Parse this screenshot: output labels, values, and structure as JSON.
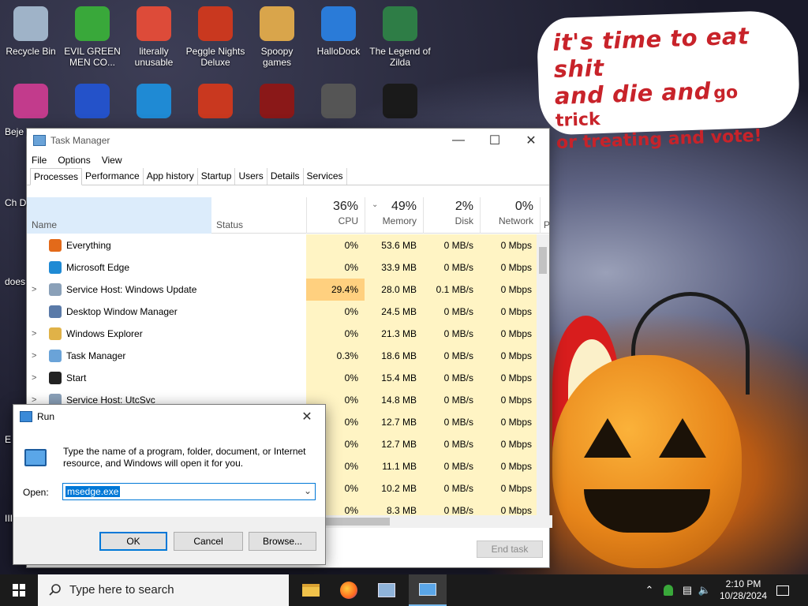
{
  "desktop": {
    "icons": [
      {
        "label": "Recycle Bin",
        "icon": "recycle-bin-icon",
        "color": "#9fb3c8"
      },
      {
        "label": "EVIL GREEN MEN CO...",
        "icon": "messenger-icon",
        "color": "#39a83a"
      },
      {
        "label": "literally unusable",
        "icon": "chrome-icon",
        "color": "#dd4b39"
      },
      {
        "label": "Peggle Nights Deluxe",
        "icon": "peggle-icon",
        "color": "#c9381f"
      },
      {
        "label": "Spoopy games",
        "icon": "folder-icon",
        "color": "#d9a54b"
      },
      {
        "label": "HalloDock",
        "icon": "windows-shield-icon",
        "color": "#2a7bd8"
      },
      {
        "label": "The Legend of Zilda",
        "icon": "zilda-icon",
        "color": "#2e7d46"
      }
    ],
    "row2_icons": [
      {
        "label": "Beje... De...",
        "icon": "bejeweled-icon",
        "color": "#c23b8c"
      },
      {
        "label": "",
        "icon": "mpl-icon",
        "color": "#2452c9"
      },
      {
        "label": "",
        "icon": "edge-icon",
        "color": "#1f8ad4"
      },
      {
        "label": "",
        "icon": "peggle-icon",
        "color": "#c9381f"
      },
      {
        "label": "",
        "icon": "flash-icon",
        "color": "#8a1818"
      },
      {
        "label": "",
        "icon": "rdp-icon",
        "color": "#555555"
      },
      {
        "label": "",
        "icon": "yashma-icon",
        "color": "#1a1a1a"
      }
    ],
    "left_edge": [
      "Beje De",
      "Ch De",
      "does",
      "E",
      "III"
    ]
  },
  "bubble": {
    "line1a": "it's time to eat shit",
    "line1b": "and die and",
    "line1c": "go trick",
    "line2": "or treating and vote!"
  },
  "task_manager": {
    "title": "Task Manager",
    "menu": [
      "File",
      "Options",
      "View"
    ],
    "tabs": [
      "Processes",
      "Performance",
      "App history",
      "Startup",
      "Users",
      "Details",
      "Services"
    ],
    "columns": {
      "name": "Name",
      "status": "Status",
      "cpu": {
        "pct": "36%",
        "label": "CPU"
      },
      "memory": {
        "pct": "49%",
        "label": "Memory"
      },
      "disk": {
        "pct": "2%",
        "label": "Disk"
      },
      "network": {
        "pct": "0%",
        "label": "Network"
      },
      "power": {
        "label": "P"
      }
    },
    "rows": [
      {
        "name": "Everything",
        "cpu": "0%",
        "memory": "53.6 MB",
        "disk": "0 MB/s",
        "network": "0 Mbps",
        "expand": "",
        "icon": "everything-icon",
        "icolor": "#e36a1a"
      },
      {
        "name": "Microsoft Edge",
        "cpu": "0%",
        "memory": "33.9 MB",
        "disk": "0 MB/s",
        "network": "0 Mbps",
        "expand": "",
        "icon": "edge-icon",
        "icolor": "#1f8ad4"
      },
      {
        "name": "Service Host: Windows Update",
        "cpu": "29.4%",
        "memory": "28.0 MB",
        "disk": "0.1 MB/s",
        "network": "0 Mbps",
        "expand": ">",
        "icon": "gear-icon",
        "icolor": "#8aa0b8"
      },
      {
        "name": "Desktop Window Manager",
        "cpu": "0%",
        "memory": "24.5 MB",
        "disk": "0 MB/s",
        "network": "0 Mbps",
        "expand": "",
        "icon": "window-icon",
        "icolor": "#5a7aa8"
      },
      {
        "name": "Windows Explorer",
        "cpu": "0%",
        "memory": "21.3 MB",
        "disk": "0 MB/s",
        "network": "0 Mbps",
        "expand": ">",
        "icon": "folder-icon",
        "icolor": "#e0b248"
      },
      {
        "name": "Task Manager",
        "cpu": "0.3%",
        "memory": "18.6 MB",
        "disk": "0 MB/s",
        "network": "0 Mbps",
        "expand": ">",
        "icon": "task-manager-icon",
        "icolor": "#6aa3d8"
      },
      {
        "name": "Start",
        "cpu": "0%",
        "memory": "15.4 MB",
        "disk": "0 MB/s",
        "network": "0 Mbps",
        "expand": ">",
        "icon": "start-icon",
        "icolor": "#222222"
      },
      {
        "name": "Service Host: UtcSvc",
        "cpu": "0%",
        "memory": "14.8 MB",
        "disk": "0 MB/s",
        "network": "0 Mbps",
        "expand": ">",
        "icon": "gear-icon",
        "icolor": "#8aa0b8"
      },
      {
        "name": "",
        "cpu": "0%",
        "memory": "12.7 MB",
        "disk": "0 MB/s",
        "network": "0 Mbps",
        "expand": "",
        "icon": "",
        "icolor": "#ffffff"
      },
      {
        "name": "",
        "cpu": "0%",
        "memory": "12.7 MB",
        "disk": "0 MB/s",
        "network": "0 Mbps",
        "expand": "",
        "icon": "",
        "icolor": "#ffffff"
      },
      {
        "name": "",
        "cpu": "0%",
        "memory": "11.1 MB",
        "disk": "0 MB/s",
        "network": "0 Mbps",
        "expand": "",
        "icon": "",
        "icolor": "#ffffff"
      },
      {
        "name": "",
        "cpu": "0%",
        "memory": "10.2 MB",
        "disk": "0 MB/s",
        "network": "0 Mbps",
        "expand": "",
        "icon": "",
        "icolor": "#ffffff"
      },
      {
        "name": "",
        "cpu": "0%",
        "memory": "8.3 MB",
        "disk": "0 MB/s",
        "network": "0 Mbps",
        "expand": "",
        "icon": "",
        "icolor": "#ffffff"
      }
    ],
    "end_task": "End task",
    "colors": {
      "cpu_low": "#fff4c4",
      "cpu_high": "#ffd07f",
      "selected_header": "#dcecfb"
    }
  },
  "run_dialog": {
    "title": "Run",
    "description": "Type the name of a program, folder, document, or Internet resource, and Windows will open it for you.",
    "open_label": "Open:",
    "open_value": "msedge.exe",
    "ok": "OK",
    "cancel": "Cancel",
    "browse": "Browse..."
  },
  "taskbar": {
    "search_placeholder": "Type here to search",
    "apps": [
      "file-explorer-icon",
      "firefox-icon",
      "task-manager-icon",
      "run-icon"
    ],
    "time": "2:10 PM",
    "date": "10/28/2024"
  }
}
